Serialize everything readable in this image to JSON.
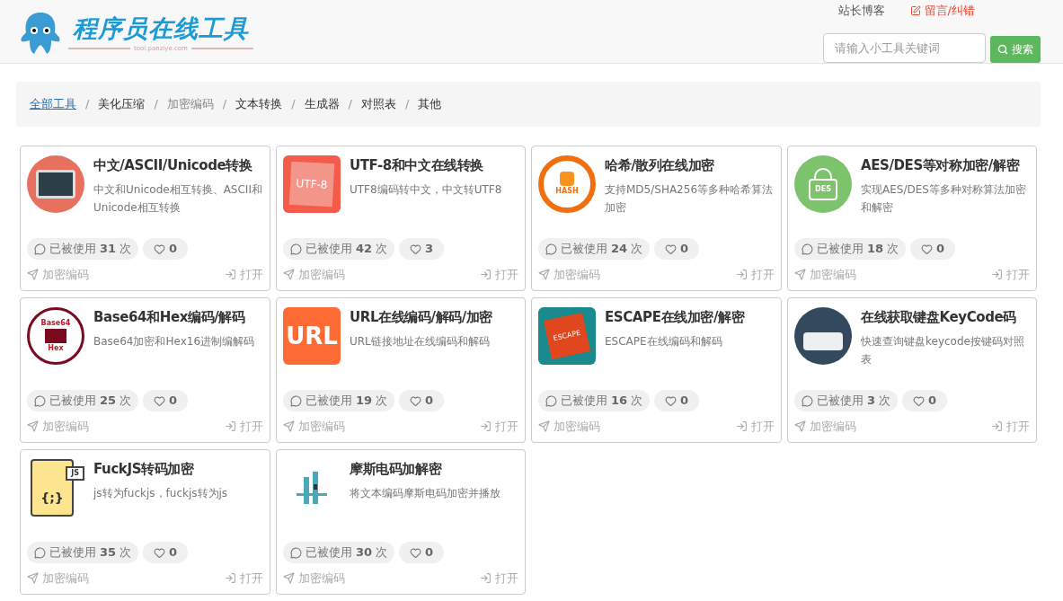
{
  "header": {
    "logo_title": "程序员在线工具",
    "logo_subtitle": "tool.panziye.com",
    "links": [
      {
        "label": "站长博客",
        "kind": "plain"
      },
      {
        "label": "留言/纠错",
        "kind": "feedback"
      }
    ],
    "search": {
      "placeholder": "请输入小工具关键词",
      "button": "搜索"
    }
  },
  "breadcrumb": [
    {
      "label": "全部工具",
      "selected": false,
      "hovered": true
    },
    {
      "label": "美化压缩",
      "selected": false,
      "hovered": false
    },
    {
      "label": "加密编码",
      "selected": true,
      "hovered": false
    },
    {
      "label": "文本转换",
      "selected": false,
      "hovered": false
    },
    {
      "label": "生成器",
      "selected": false,
      "hovered": false
    },
    {
      "label": "对照表",
      "selected": false,
      "hovered": false
    },
    {
      "label": "其他",
      "selected": false,
      "hovered": false
    }
  ],
  "separator": "/",
  "tools": [
    {
      "kind": "terminal",
      "title": "中文/ASCII/Unicode转换",
      "desc": "中文和Unicode相互转换、ASCII和Unicode相互转换",
      "uses_label": "已被使用",
      "uses": "31",
      "uses_unit": "次",
      "likes": "0",
      "category": "加密编码",
      "open": "打开"
    },
    {
      "kind": "utf8",
      "icon_text": [
        "UTF-8"
      ],
      "title": "UTF-8和中文在线转换",
      "desc": "UTF8编码转中文，中文转UTF8",
      "uses_label": "已被使用",
      "uses": "42",
      "uses_unit": "次",
      "likes": "3",
      "category": "加密编码",
      "open": "打开"
    },
    {
      "kind": "hash",
      "icon_text": [
        "HASH"
      ],
      "title": "哈希/散列在线加密",
      "desc": "支持MD5/SHA256等多种哈希算法加密",
      "uses_label": "已被使用",
      "uses": "24",
      "uses_unit": "次",
      "likes": "0",
      "category": "加密编码",
      "open": "打开"
    },
    {
      "kind": "des",
      "icon_text": [
        "DES"
      ],
      "title": "AES/DES等对称加密/解密",
      "desc": "实现AES/DES等多种对称算法加密和解密",
      "uses_label": "已被使用",
      "uses": "18",
      "uses_unit": "次",
      "likes": "0",
      "category": "加密编码",
      "open": "打开"
    },
    {
      "kind": "base64",
      "icon_text": [
        "Base64",
        "Hex"
      ],
      "title": "Base64和Hex编码/解码",
      "desc": "Base64加密和Hex16进制编解码",
      "uses_label": "已被使用",
      "uses": "25",
      "uses_unit": "次",
      "likes": "0",
      "category": "加密编码",
      "open": "打开"
    },
    {
      "kind": "url",
      "icon_text": [
        "URL"
      ],
      "title": "URL在线编码/解码/加密",
      "desc": "URL链接地址在线编码和解码",
      "uses_label": "已被使用",
      "uses": "19",
      "uses_unit": "次",
      "likes": "0",
      "category": "加密编码",
      "open": "打开"
    },
    {
      "kind": "escape",
      "icon_text": [
        "ESCAPE"
      ],
      "title": "ESCAPE在线加密/解密",
      "desc": "ESCAPE在线编码和解码",
      "uses_label": "已被使用",
      "uses": "16",
      "uses_unit": "次",
      "likes": "0",
      "category": "加密编码",
      "open": "打开"
    },
    {
      "kind": "keyboard",
      "title": "在线获取键盘KeyCode码",
      "desc": "快速查询键盘keycode按键码对照表",
      "uses_label": "已被使用",
      "uses": "3",
      "uses_unit": "次",
      "likes": "0",
      "category": "加密编码",
      "open": "打开"
    },
    {
      "kind": "js",
      "icon_text": [
        "JS",
        "{;}"
      ],
      "title": "FuckJS转码加密",
      "desc": "js转为fuckjs，fuckjs转为js",
      "uses_label": "已被使用",
      "uses": "35",
      "uses_unit": "次",
      "likes": "0",
      "category": "加密编码",
      "open": "打开"
    },
    {
      "kind": "morse",
      "title": "摩斯电码加解密",
      "desc": "将文本编码摩斯电码加密并播放",
      "uses_label": "已被使用",
      "uses": "30",
      "uses_unit": "次",
      "likes": "0",
      "category": "加密编码",
      "open": "打开"
    }
  ]
}
